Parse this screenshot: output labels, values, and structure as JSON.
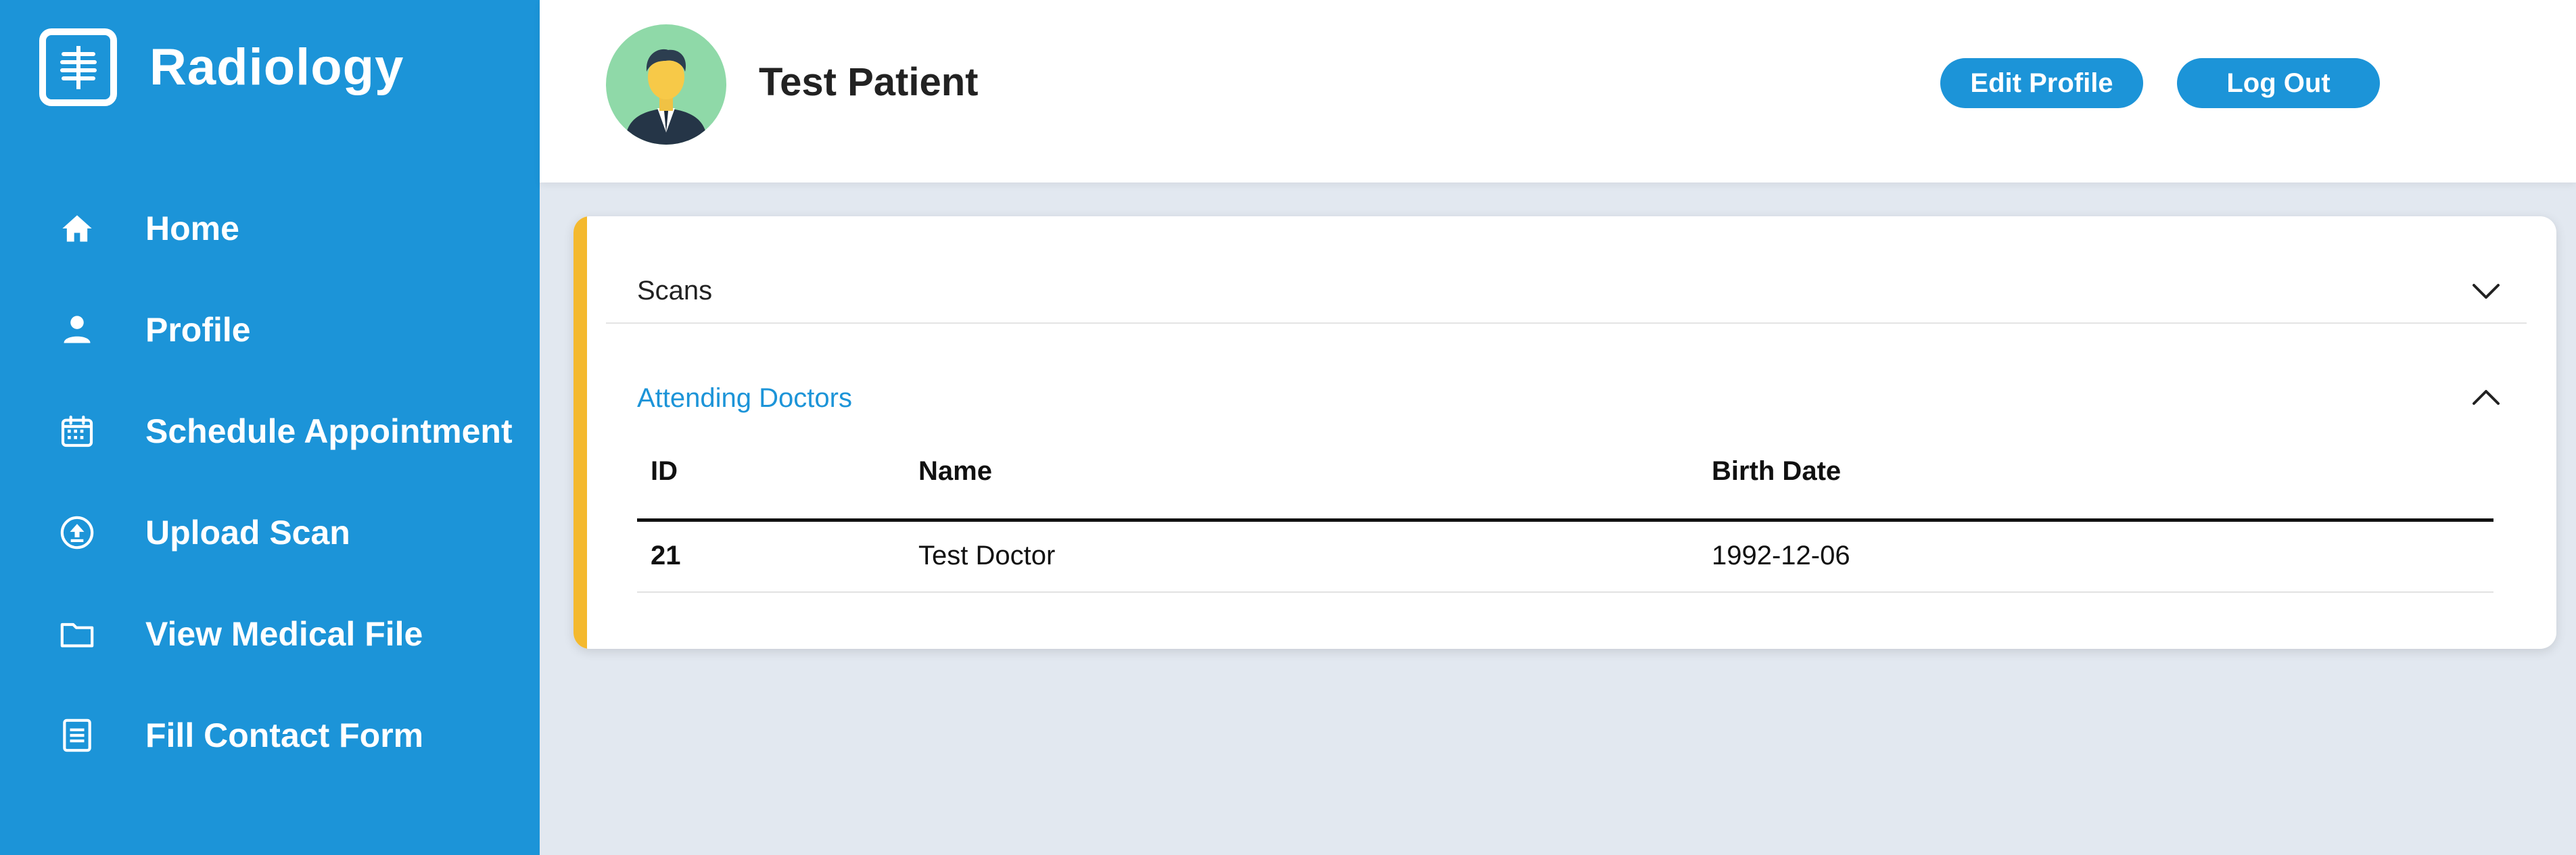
{
  "sidebar": {
    "brand": {
      "title": "Radiology",
      "icon": "xray-icon"
    },
    "items": [
      {
        "label": "Home",
        "icon": "home-icon"
      },
      {
        "label": "Profile",
        "icon": "user-icon"
      },
      {
        "label": "Schedule Appointment",
        "icon": "calendar-icon"
      },
      {
        "label": "Upload Scan",
        "icon": "upload-icon"
      },
      {
        "label": "View Medical File",
        "icon": "folder-icon"
      },
      {
        "label": "Fill Contact Form",
        "icon": "form-icon"
      }
    ]
  },
  "header": {
    "user_name": "Test Patient",
    "avatar_icon": "user-avatar-icon",
    "edit_profile_label": "Edit Profile",
    "logout_label": "Log Out"
  },
  "accordion": {
    "sections": [
      {
        "title": "Scans",
        "expanded": false
      },
      {
        "title": "Attending Doctors",
        "expanded": true
      }
    ]
  },
  "doctors_table": {
    "columns": [
      "ID",
      "Name",
      "Birth Date"
    ],
    "rows": [
      {
        "id": "21",
        "name": "Test Doctor",
        "birth_date": "1992-12-06"
      }
    ]
  },
  "colors": {
    "primary": "#1c94d8",
    "accent": "#f4b92e",
    "background": "#e2e8f0",
    "avatar_bg": "#8fd9a8"
  }
}
